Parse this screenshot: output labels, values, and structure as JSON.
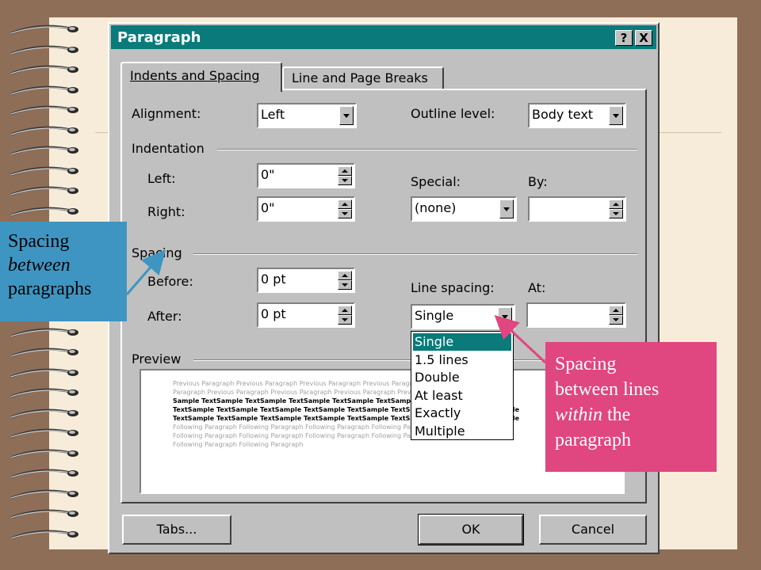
{
  "dialog": {
    "title": "Paragraph",
    "help_button": "?",
    "close_button": "X",
    "tabs": [
      {
        "label": "Indents and Spacing",
        "active": true
      },
      {
        "label": "Line and Page Breaks",
        "active": false
      }
    ],
    "general": {
      "alignment_label": "Alignment:",
      "alignment_value": "Left",
      "outline_level_label": "Outline level:",
      "outline_level_value": "Body text"
    },
    "indentation": {
      "section_label": "Indentation",
      "left_label": "Left:",
      "left_value": "0\"",
      "right_label": "Right:",
      "right_value": "0\"",
      "special_label": "Special:",
      "special_value": "(none)",
      "by_label": "By:",
      "by_value": ""
    },
    "spacing": {
      "section_label": "Spacing",
      "before_label": "Before:",
      "before_value": "0 pt",
      "after_label": "After:",
      "after_value": "0 pt",
      "line_spacing_label": "Line spacing:",
      "line_spacing_value": "Single",
      "at_label": "At:",
      "at_value": ""
    },
    "line_spacing_options": [
      "Single",
      "1.5 lines",
      "Double",
      "At least",
      "Exactly",
      "Multiple"
    ],
    "line_spacing_selected": "Single",
    "preview": {
      "section_label": "Preview",
      "lines": [
        {
          "style": "gray",
          "text": "Previous Paragraph Previous Paragraph Previous Paragraph Previous Paragraph Previous"
        },
        {
          "style": "gray",
          "text": "Paragraph Previous Paragraph Previous Paragraph Previous Paragraph Previous Paragraph"
        },
        {
          "style": "dark",
          "text": "Sample TextSample TextSample TextSample TextSample TextSample TextSample TextSample"
        },
        {
          "style": "dark",
          "text": "TextSample TextSample TextSample TextSample TextSample TextSample TextSample TextSample"
        },
        {
          "style": "dark",
          "text": "TextSample TextSample TextSample TextSample TextSample TextSample TextSample TextSample"
        },
        {
          "style": "gray",
          "text": "Following Paragraph Following Paragraph Following Paragraph Following Paragraph"
        },
        {
          "style": "gray",
          "text": "Following Paragraph Following Paragraph Following Paragraph Following Paragraph"
        },
        {
          "style": "gray",
          "text": "Following Paragraph Following Paragraph"
        }
      ]
    },
    "buttons": {
      "tabs": "Tabs...",
      "ok": "OK",
      "cancel": "Cancel"
    }
  },
  "annotations": {
    "left_note": {
      "line1": "Spacing",
      "line2": "between",
      "line3": "paragraphs"
    },
    "right_note": {
      "line1": "Spacing",
      "line2": "between lines",
      "line3a": "within",
      "line3b": " the",
      "line4": "paragraph"
    }
  },
  "colors": {
    "background": "#8f6e58",
    "paper": "#f7ecd9",
    "titlebar": "#0a7a7a",
    "dialog_face": "#c0c0c0",
    "left_note": "#3e95c2",
    "right_note": "#e0467f"
  }
}
